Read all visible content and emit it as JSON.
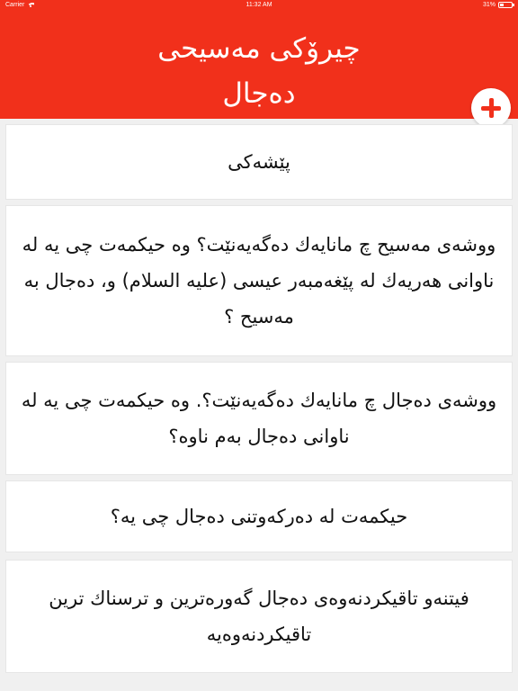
{
  "status_bar": {
    "carrier": "Carrier",
    "time": "11:32 AM",
    "battery": "31%"
  },
  "header": {
    "title_line1": "چیرۆکی مەسیحی",
    "title_line2": "دەجال",
    "accent_color": "#f1301b"
  },
  "list": {
    "items": [
      {
        "text": "پێشەکی"
      },
      {
        "text": "ووشەی مەسیح چ مانایەك دەگەیەنێت؟ وە حیکمەت چی یە لە ناوانی هەریەك لە پێغەمبەر عیسی (علیه السلام) و، دەجال بە مەسیح ؟"
      },
      {
        "text": "ووشەی دەجال چ مانایەك دەگەیەنێت؟. وە حیکمەت چی یە لە ناوانی دەجال بەم ناوە؟"
      },
      {
        "text": "حیکمەت لە دەرکەوتنی دەجال چی یە؟"
      },
      {
        "text": "فیتنەو تاقیکردنەوەی دەجال گەورەترین و ترسناك ترین تاقیکردنەوەیە"
      }
    ]
  }
}
